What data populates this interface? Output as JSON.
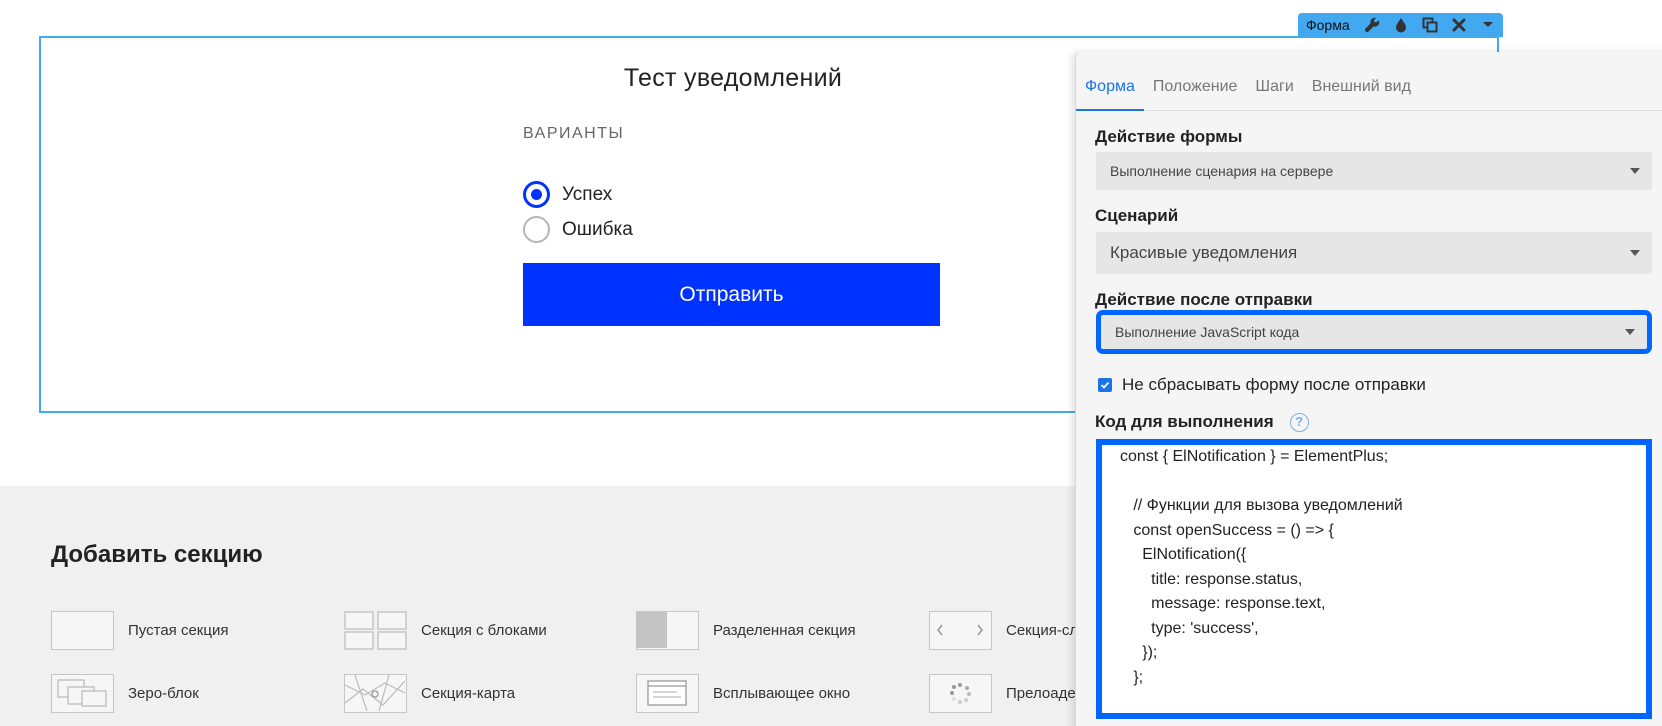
{
  "form": {
    "title": "Тест уведомлений",
    "variants_label": "ВАРИАНТЫ",
    "options": [
      {
        "label": "Успех",
        "checked": true
      },
      {
        "label": "Ошибка",
        "checked": false
      }
    ],
    "submit_label": "Отправить"
  },
  "toolbar": {
    "label": "Форма",
    "icons": [
      "wrench-icon",
      "drop-icon",
      "duplicate-icon",
      "close-icon",
      "chevron-down-icon"
    ]
  },
  "add_section": {
    "title": "Добавить секцию",
    "items": [
      {
        "label": "Пустая секция"
      },
      {
        "label": "Секция с блоками"
      },
      {
        "label": "Разделенная секция"
      },
      {
        "label": "Секция-сл"
      },
      {
        "label": "Зеро-блок"
      },
      {
        "label": "Секция-карта"
      },
      {
        "label": "Всплывающее окно"
      },
      {
        "label": "Прелоаде"
      }
    ]
  },
  "panel": {
    "tabs": [
      {
        "label": "Форма",
        "active": true
      },
      {
        "label": "Положение",
        "active": false
      },
      {
        "label": "Шаги",
        "active": false
      },
      {
        "label": "Внешний вид",
        "active": false
      }
    ],
    "form_action": {
      "label": "Действие формы",
      "value": "Выполнение сценария на сервере"
    },
    "scenario": {
      "label": "Сценарий",
      "value": "Красивые уведомления"
    },
    "after_submit": {
      "label": "Действие после отправки",
      "value": "Выполнение JavaScript кода"
    },
    "no_reset": {
      "label": "Не сбрасывать форму после отправки",
      "checked": true
    },
    "code": {
      "label": "Код для выполнения",
      "help": "?",
      "lines": [
        "const { ElNotification } = ElementPlus;",
        "",
        "   // Функции для вызова уведомлений",
        "   const openSuccess = () => {",
        "     ElNotification({",
        "       title: response.status,",
        "       message: response.text,",
        "       type: 'success',",
        "     });",
        "   };"
      ]
    }
  },
  "colors": {
    "accent": "#0033ff",
    "highlight": "#0066ff",
    "selection": "#42a9f1",
    "tab_active": "#1a73e8"
  }
}
